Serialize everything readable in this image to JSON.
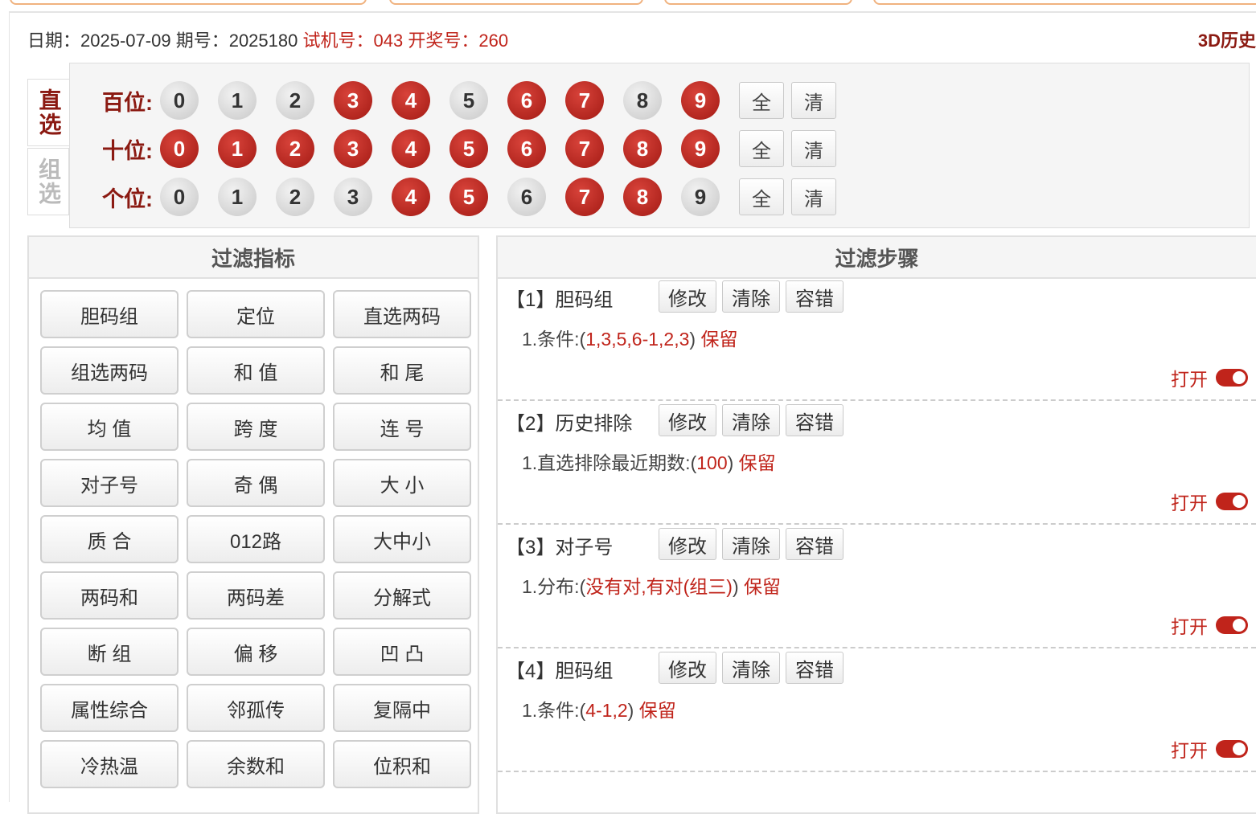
{
  "header": {
    "date_label": "日期：",
    "date": "2025-07-09",
    "issue_label": "期号：",
    "issue": "2025180",
    "trial_label": "试机号：",
    "trial": "043",
    "draw_label": "开奖号：",
    "draw": "260",
    "history_link": "3D历史"
  },
  "mode_tabs": {
    "direct": "直选",
    "group": "组选"
  },
  "positions": [
    {
      "label": "百位:",
      "balls": [
        {
          "n": "0",
          "on": false
        },
        {
          "n": "1",
          "on": false
        },
        {
          "n": "2",
          "on": false
        },
        {
          "n": "3",
          "on": true
        },
        {
          "n": "4",
          "on": true
        },
        {
          "n": "5",
          "on": false
        },
        {
          "n": "6",
          "on": true
        },
        {
          "n": "7",
          "on": true
        },
        {
          "n": "8",
          "on": false
        },
        {
          "n": "9",
          "on": true
        }
      ]
    },
    {
      "label": "十位:",
      "balls": [
        {
          "n": "0",
          "on": true
        },
        {
          "n": "1",
          "on": true
        },
        {
          "n": "2",
          "on": true
        },
        {
          "n": "3",
          "on": true
        },
        {
          "n": "4",
          "on": true
        },
        {
          "n": "5",
          "on": true
        },
        {
          "n": "6",
          "on": true
        },
        {
          "n": "7",
          "on": true
        },
        {
          "n": "8",
          "on": true
        },
        {
          "n": "9",
          "on": true
        }
      ]
    },
    {
      "label": "个位:",
      "balls": [
        {
          "n": "0",
          "on": false
        },
        {
          "n": "1",
          "on": false
        },
        {
          "n": "2",
          "on": false
        },
        {
          "n": "3",
          "on": false
        },
        {
          "n": "4",
          "on": true
        },
        {
          "n": "5",
          "on": true
        },
        {
          "n": "6",
          "on": false
        },
        {
          "n": "7",
          "on": true
        },
        {
          "n": "8",
          "on": true
        },
        {
          "n": "9",
          "on": false
        }
      ]
    }
  ],
  "select_all_label": "全",
  "clear_label": "清",
  "filter_panel": {
    "title": "过滤指标",
    "buttons": [
      "胆码组",
      "定位",
      "直选两码",
      "组选两码",
      "和 值",
      "和 尾",
      "均 值",
      "跨 度",
      "连 号",
      "对子号",
      "奇 偶",
      "大 小",
      "质 合",
      "012路",
      "大中小",
      "两码和",
      "两码差",
      "分解式",
      "断 组",
      "偏 移",
      "凹 凸",
      "属性综合",
      "邻孤传",
      "复隔中",
      "冷热温",
      "余数和",
      "位积和"
    ]
  },
  "steps_panel": {
    "title": "过滤步骤",
    "edit_label": "修改",
    "clear_label": "清除",
    "tolerance_label": "容错",
    "toggle_label": "打开",
    "steps": [
      {
        "title": "【1】胆码组",
        "cond_prefix": "1.条件:(",
        "cond_value": "1,3,5,6-1,2,3",
        "cond_suffix": ")",
        "action": "保留"
      },
      {
        "title": "【2】历史排除",
        "cond_prefix": "1.直选排除最近期数:(",
        "cond_value": "100",
        "cond_suffix": ")",
        "action": "保留"
      },
      {
        "title": "【3】对子号",
        "cond_prefix": "1.分布:(",
        "cond_value": "没有对,有对(组三)",
        "cond_suffix": ")",
        "action": "保留"
      },
      {
        "title": "【4】胆码组",
        "cond_prefix": "1.条件:(",
        "cond_value": "4-1,2",
        "cond_suffix": ")",
        "action": "保留"
      }
    ]
  }
}
